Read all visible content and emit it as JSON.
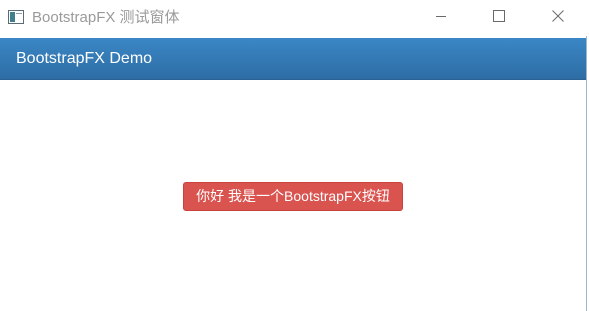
{
  "window": {
    "title": "BootstrapFX 测试窗体",
    "icon": "app-window-icon",
    "controls": {
      "minimize_icon": "minimize-icon",
      "maximize_icon": "maximize-icon",
      "close_icon": "close-icon"
    }
  },
  "header": {
    "title": "BootstrapFX Demo",
    "color": "#337ab7"
  },
  "main": {
    "button_label": "你好 我是一个BootstrapFX按钮",
    "button_color": "#d9534f"
  }
}
